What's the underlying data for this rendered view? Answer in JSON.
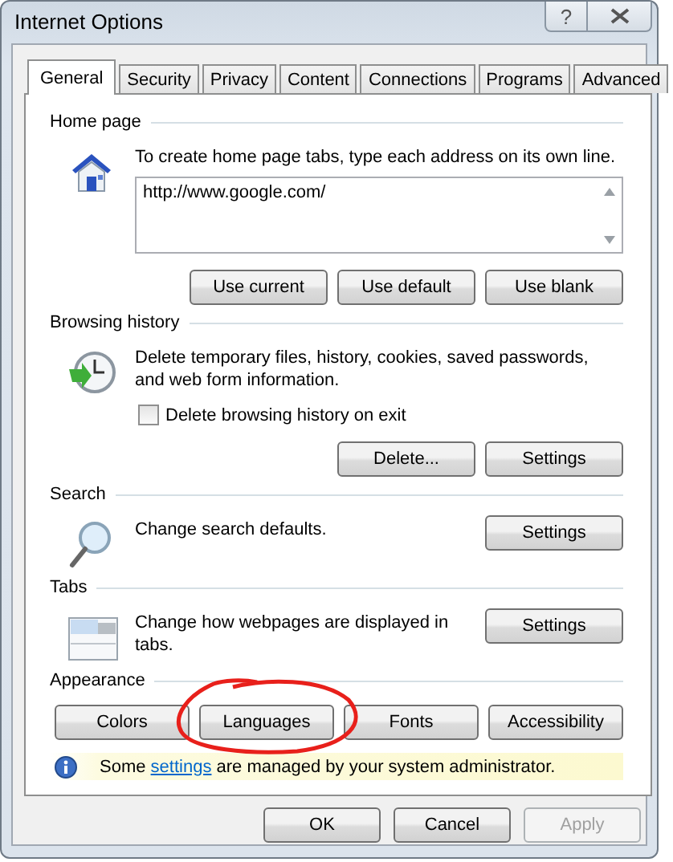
{
  "window": {
    "title": "Internet Options",
    "help": "?"
  },
  "tabs": [
    {
      "label": "General",
      "selected": true
    },
    {
      "label": "Security",
      "selected": false
    },
    {
      "label": "Privacy",
      "selected": false
    },
    {
      "label": "Content",
      "selected": false
    },
    {
      "label": "Connections",
      "selected": false
    },
    {
      "label": "Programs",
      "selected": false
    },
    {
      "label": "Advanced",
      "selected": false
    }
  ],
  "sections": [
    {
      "label": "Home page",
      "kind": "house",
      "description": "To create home page tabs, type each address on its own line.",
      "address": "http://www.google.com/",
      "buttons": [
        "Use current",
        "Use default",
        "Use blank"
      ]
    },
    {
      "label": "Browsing history",
      "kind": "clock",
      "description": "Delete temporary files, history, cookies, saved passwords, and web form information.",
      "checkbox": {
        "label": "Delete browsing history on exit",
        "checked": false
      },
      "buttons": [
        "Delete...",
        "Settings"
      ]
    },
    {
      "label": "Search",
      "kind": "magnifier",
      "description": "Change search defaults.",
      "buttons": [
        "Settings"
      ]
    },
    {
      "label": "Tabs",
      "kind": "tabs",
      "description": "Change how webpages are displayed in tabs.",
      "buttons": [
        "Settings"
      ]
    },
    {
      "label": "Appearance",
      "buttons": [
        "Colors",
        "Languages",
        "Fonts",
        "Accessibility"
      ]
    }
  ],
  "info_bar": {
    "text_before": "Some ",
    "link": "settings",
    "text_after": " are managed by your system administrator."
  },
  "dialog_buttons": [
    {
      "label": "OK",
      "disabled": false
    },
    {
      "label": "Cancel",
      "disabled": false
    },
    {
      "label": "Apply",
      "disabled": true
    }
  ],
  "annotations": [
    {
      "kind": "circle"
    }
  ]
}
